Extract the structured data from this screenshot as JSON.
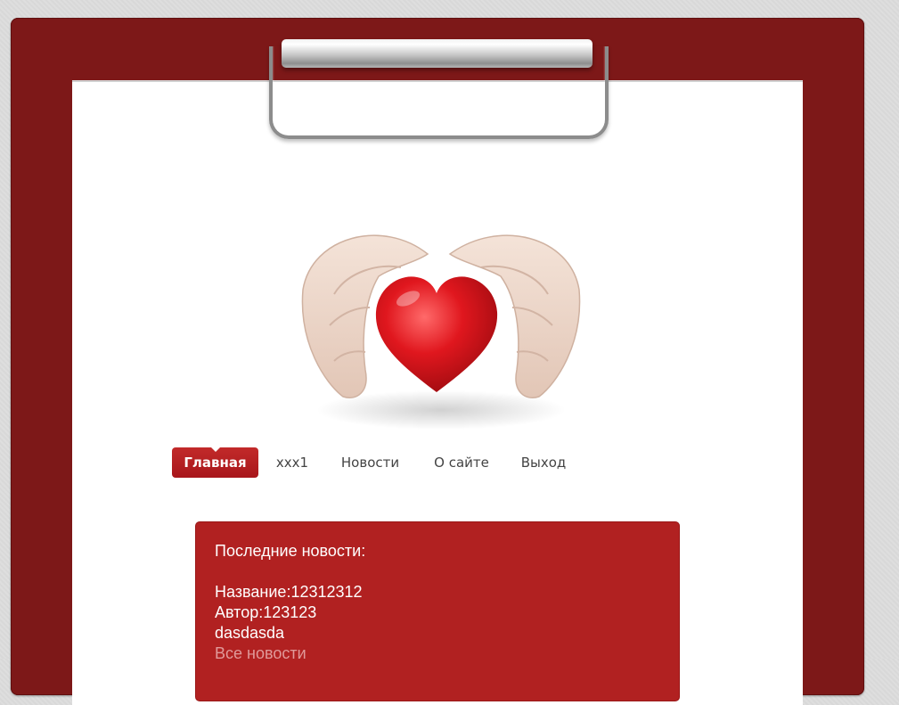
{
  "nav": {
    "items": [
      {
        "label": "Главная"
      },
      {
        "label": "xxx1"
      },
      {
        "label": "Новости"
      },
      {
        "label": "О сайте"
      },
      {
        "label": "Выход"
      }
    ],
    "active_index": 0
  },
  "news": {
    "heading": "Последние новости:",
    "title_line": "Название:12312312",
    "author_line": "Автор:123123",
    "body_line": "dasdasda",
    "all_news_link": "Все новости"
  },
  "colors": {
    "board": "#7d1818",
    "accent": "#b12121",
    "heart": "#e0171e"
  },
  "hero": {
    "icon": "heart-in-hands-icon"
  }
}
